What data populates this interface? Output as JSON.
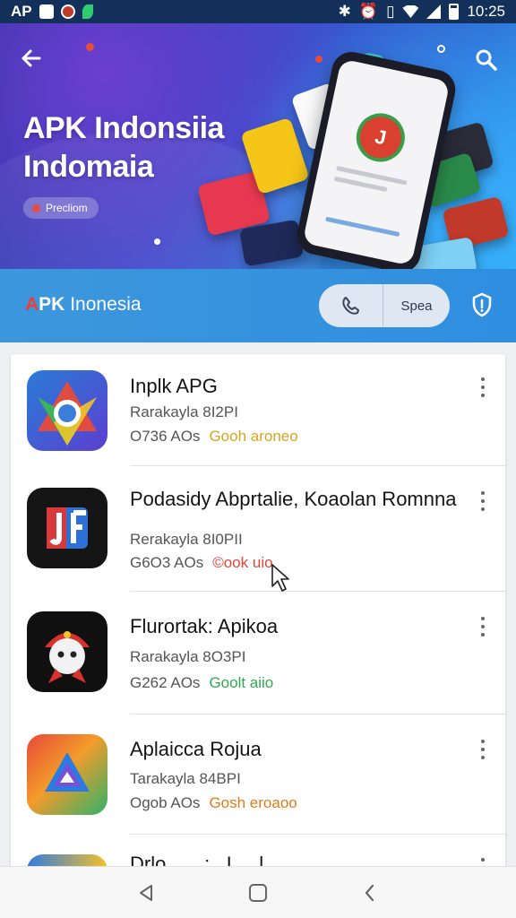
{
  "status_bar": {
    "carrier": "AP",
    "time": "10:25"
  },
  "hero": {
    "title_line1": "APK Indonsiia",
    "title_line2": "Indomaia",
    "badge": "Precliom",
    "phone_logo": "J"
  },
  "toolbar": {
    "brand_a": "A",
    "brand_pk": "PK",
    "brand_rest": " Inonesia",
    "search_label": "Spea"
  },
  "apps": [
    {
      "title": "Inplk APG",
      "subtitle": "Rarakayla 8I2PI",
      "size": "O736 AOs",
      "tag": "Gooh aroneo",
      "tag_color": "#d6a41f"
    },
    {
      "title": "Podasidy Abprtalie, Koaolan Romnna",
      "subtitle": "Rerakayla 8I0PII",
      "size": "G6O3 AOs",
      "tag": "©ook uio",
      "tag_color": "#e0453a"
    },
    {
      "title": "Flurortak: Apikoa",
      "subtitle": "Rarakayla 8O3PI",
      "size": "G262 AOs",
      "tag": "Goolt aiio",
      "tag_color": "#2fa84f"
    },
    {
      "title": "Aplaicca Rojua",
      "subtitle": "Tarakayla 84BPI",
      "size": "Ogob AOs",
      "tag": "Gosh eroaoo",
      "tag_color": "#e07b1a"
    },
    {
      "title": "Drlo.......:.. I.....l",
      "subtitle": "",
      "size": "",
      "tag": "",
      "tag_color": "#555555"
    }
  ],
  "colors": {
    "status_bar": "#12305a",
    "toolbar": "#3d97dc",
    "brand_accent": "#e8413a"
  },
  "icons": [
    "back-arrow-icon",
    "search-icon",
    "shield-icon",
    "phone-icon",
    "more-vert-icon",
    "nav-back-icon",
    "nav-home-icon",
    "nav-recents-icon",
    "cursor-icon"
  ]
}
